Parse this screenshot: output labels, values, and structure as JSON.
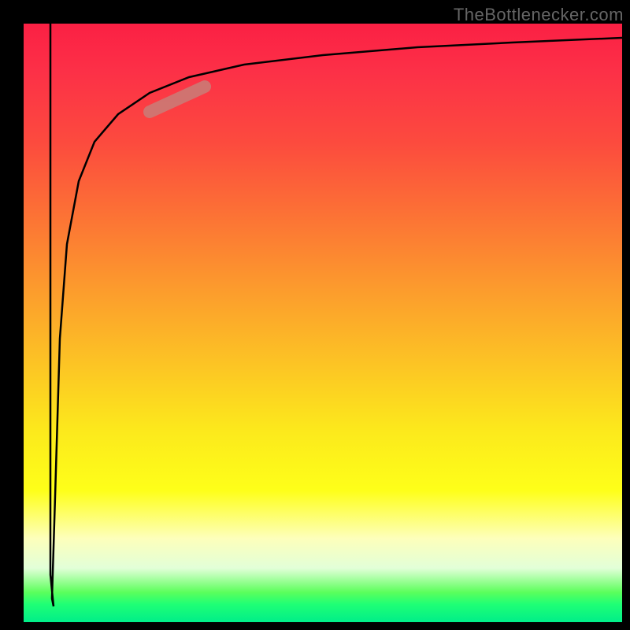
{
  "watermark": "TheBottlenecker.com",
  "chart_data": {
    "type": "line",
    "title": "",
    "xlabel": "",
    "ylabel": "",
    "xlim": [
      0,
      100
    ],
    "ylim": [
      0,
      100
    ],
    "gradient_colors": {
      "top": "#fb2044",
      "middle": "#fce91c",
      "bottom": "#00ee89"
    },
    "curve_points": [
      {
        "x": 4.5,
        "y": 0
      },
      {
        "x": 4.5,
        "y": 92
      },
      {
        "x": 5.0,
        "y": 2
      },
      {
        "x": 6,
        "y": 60
      },
      {
        "x": 8,
        "y": 75
      },
      {
        "x": 12,
        "y": 83
      },
      {
        "x": 20,
        "y": 88
      },
      {
        "x": 30,
        "y": 91
      },
      {
        "x": 50,
        "y": 94
      },
      {
        "x": 70,
        "y": 95.5
      },
      {
        "x": 100,
        "y": 97
      }
    ],
    "highlight_segment": {
      "x_start": 21,
      "y_start": 85,
      "x_end": 30,
      "y_end": 89,
      "color": "#c87e78",
      "width": 14
    }
  }
}
